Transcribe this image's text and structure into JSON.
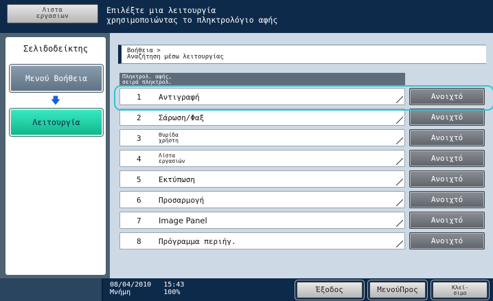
{
  "header": {
    "job_list_button": "Λιστα\nεργασιων",
    "message": "Επιλέξτε μια λειτουργία\nχρησιμοποιώντας το πληκτρολόγιο αφής"
  },
  "sidebar": {
    "tab_label": "Σελιδοδείκτης",
    "items": [
      {
        "label": "Μενού Βοήθεια"
      },
      {
        "label": "Λειτουργία"
      }
    ],
    "arrow_icon": "arrow-down-icon",
    "colors": {
      "active": "#1cd3a6",
      "inactive": "#6f8395",
      "arrow": "#1a5fd8"
    }
  },
  "main": {
    "breadcrumb": "Βοήθεια >\nΑναζήτηση μέσω λειτουργίας",
    "list_header": "Πληκτρολ. αφής,\nσειρά πληκτρολ.",
    "open_label": "Ανοιχτό",
    "rows": [
      {
        "num": "1",
        "label": "Αντιγραφή"
      },
      {
        "num": "2",
        "label": "Σάρωση/Φαξ"
      },
      {
        "num": "3",
        "label": "Θυρίδα\nχρήστη"
      },
      {
        "num": "4",
        "label": "Λίστα\nεργασιών"
      },
      {
        "num": "5",
        "label": "Εκτύπωση"
      },
      {
        "num": "6",
        "label": "Προσαρμογή"
      },
      {
        "num": "7",
        "label": "Image Panel"
      },
      {
        "num": "8",
        "label": "Πρόγραμμα περιήγ."
      }
    ],
    "colors": {
      "highlight": "#31c5d0",
      "background": "#cdd9e4"
    }
  },
  "footer": {
    "date": "08/04/2010",
    "time": "15:43",
    "memory_label": "Μνήμη",
    "memory_value": "100%",
    "buttons": {
      "exit": "Έξοδος",
      "menu_top": "ΜενούΠρος",
      "close": "Κλεί-\nσιμο"
    }
  }
}
